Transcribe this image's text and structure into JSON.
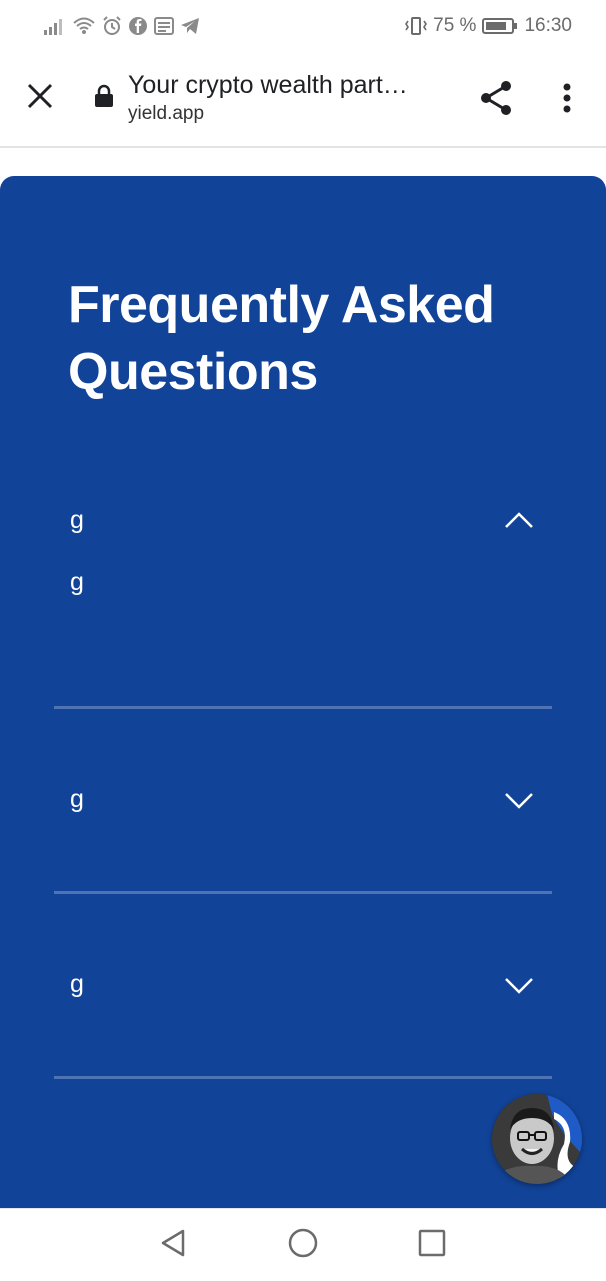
{
  "status_bar": {
    "battery_percent": "75 %",
    "time": "16:30"
  },
  "browser": {
    "page_title": "Your crypto wealth part…",
    "domain": "yield.app"
  },
  "faq": {
    "title": "Frequently Asked Questions",
    "items": [
      {
        "question": "g",
        "answer": "g",
        "expanded": true
      },
      {
        "question": "g",
        "expanded": false
      },
      {
        "question": "g",
        "expanded": false
      }
    ]
  },
  "colors": {
    "card_background": "#114398",
    "divider": "#4f73b3",
    "text_on_card": "#ffffff"
  },
  "icons": {
    "close": "close-icon",
    "lock": "lock-icon",
    "share": "share-icon",
    "menu": "more-vert-icon",
    "chevron_up": "chevron-up-icon",
    "chevron_down": "chevron-down-icon",
    "back": "back-triangle-icon",
    "home": "home-circle-icon",
    "recents": "recents-square-icon"
  }
}
